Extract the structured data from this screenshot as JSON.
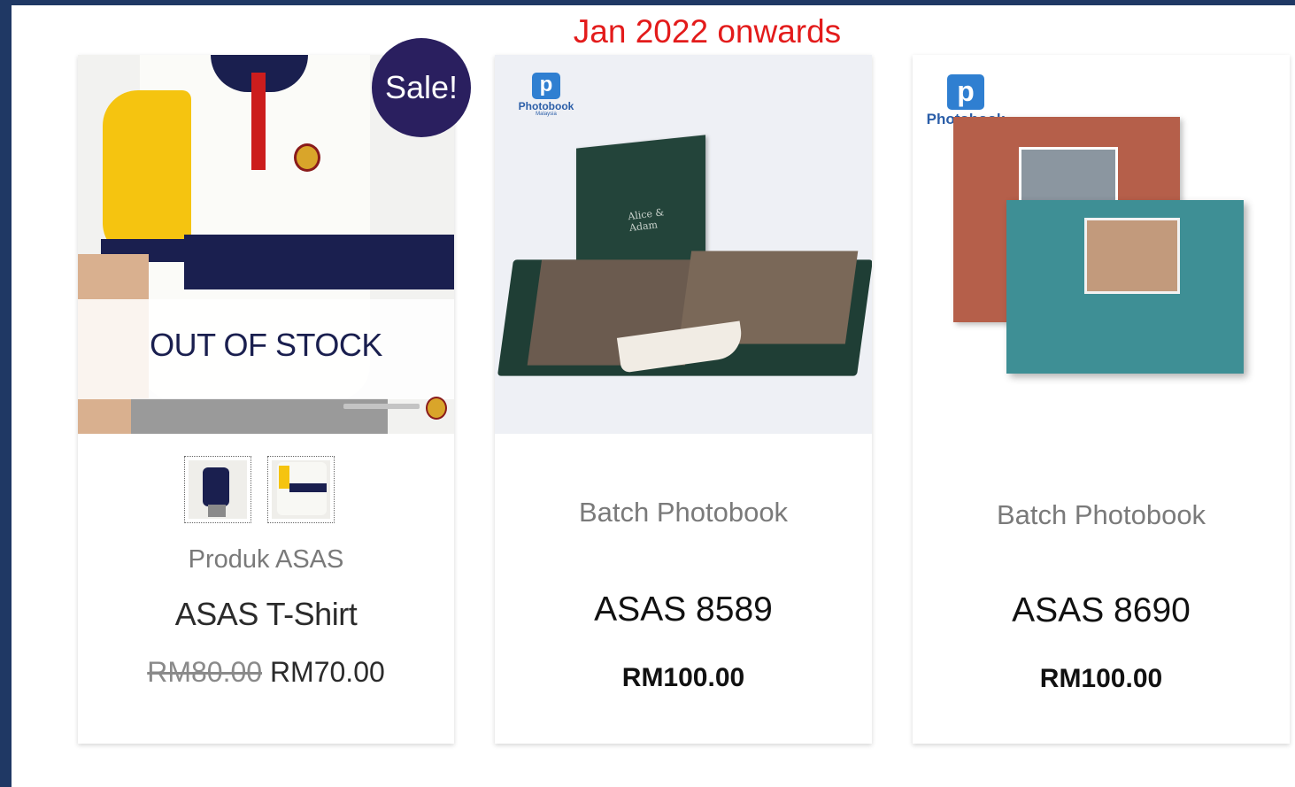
{
  "banner": {
    "text": "Jan 2022 onwards",
    "color": "#e31b1b"
  },
  "frame": {
    "color": "#1f3864"
  },
  "products": [
    {
      "badge": "Sale!",
      "status_overlay": "OUT OF STOCK",
      "thumbnails": [
        "shirt-back-thumbnail",
        "shirt-front-thumbnail"
      ],
      "category": "Produk ASAS",
      "name": "ASAS T-Shirt",
      "price_old": "RM80.00",
      "price_new": "RM70.00"
    },
    {
      "brand_logo": {
        "mark": "p",
        "word": "Photobook",
        "sub": "Malaysia"
      },
      "cover_text": "Alice & Adam",
      "category": "Batch Photobook",
      "name": "ASAS 8589",
      "price": "RM100.00"
    },
    {
      "brand_logo": {
        "mark": "p",
        "word": "Photobook"
      },
      "category": "Batch Photobook",
      "name": "ASAS 8690",
      "price": "RM100.00"
    }
  ]
}
